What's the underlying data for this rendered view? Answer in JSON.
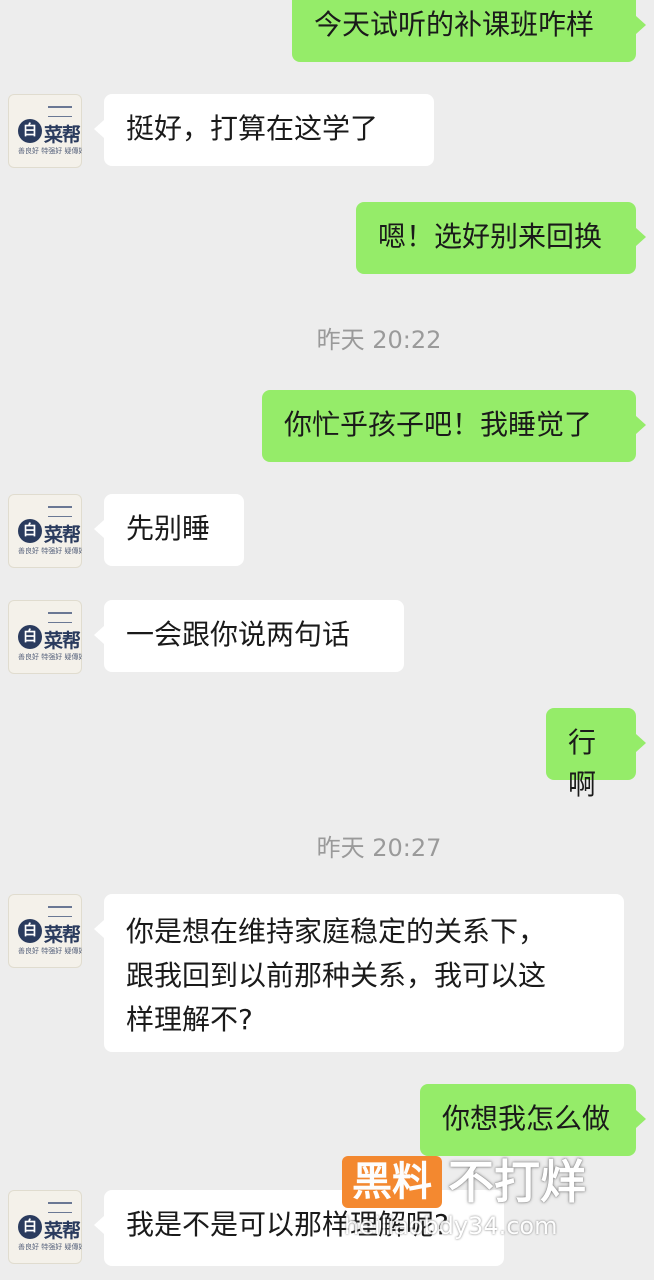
{
  "avatar": {
    "icon_name": "cai-bang-logo-avatar",
    "glyph": "白",
    "name": "菜帮",
    "subtitle": "善良好 特强好 疑傳好"
  },
  "messages": [
    {
      "side": "right",
      "text": "今天试听的补课班咋样"
    },
    {
      "side": "left",
      "text": "挺好，打算在这学了"
    },
    {
      "side": "right",
      "text": "嗯！选好别来回换"
    },
    {
      "side": "time",
      "text": "昨天 20:22"
    },
    {
      "side": "right",
      "text": "你忙乎孩子吧！我睡觉了"
    },
    {
      "side": "left",
      "text": "先别睡"
    },
    {
      "side": "left",
      "text": "一会跟你说两句话"
    },
    {
      "side": "right",
      "text": "行啊"
    },
    {
      "side": "time",
      "text": "昨天 20:27"
    },
    {
      "side": "left",
      "lines": [
        "你是想在维持家庭稳定的关系下，",
        "跟我回到以前那种关系，我可以这",
        "样理解不?"
      ]
    },
    {
      "side": "right",
      "text": "你想我怎么做"
    },
    {
      "side": "left",
      "text": "我是不是可以那样理解呢?"
    }
  ],
  "watermark": {
    "box_text": "黑料",
    "text": "不打烊",
    "url": "heiliaobdy34.com",
    "accent_color": "#f4801f"
  },
  "colors": {
    "background": "#ededed",
    "bubble_self": "#95ec69",
    "bubble_other": "#ffffff",
    "timestamp": "#9a9a9a"
  }
}
